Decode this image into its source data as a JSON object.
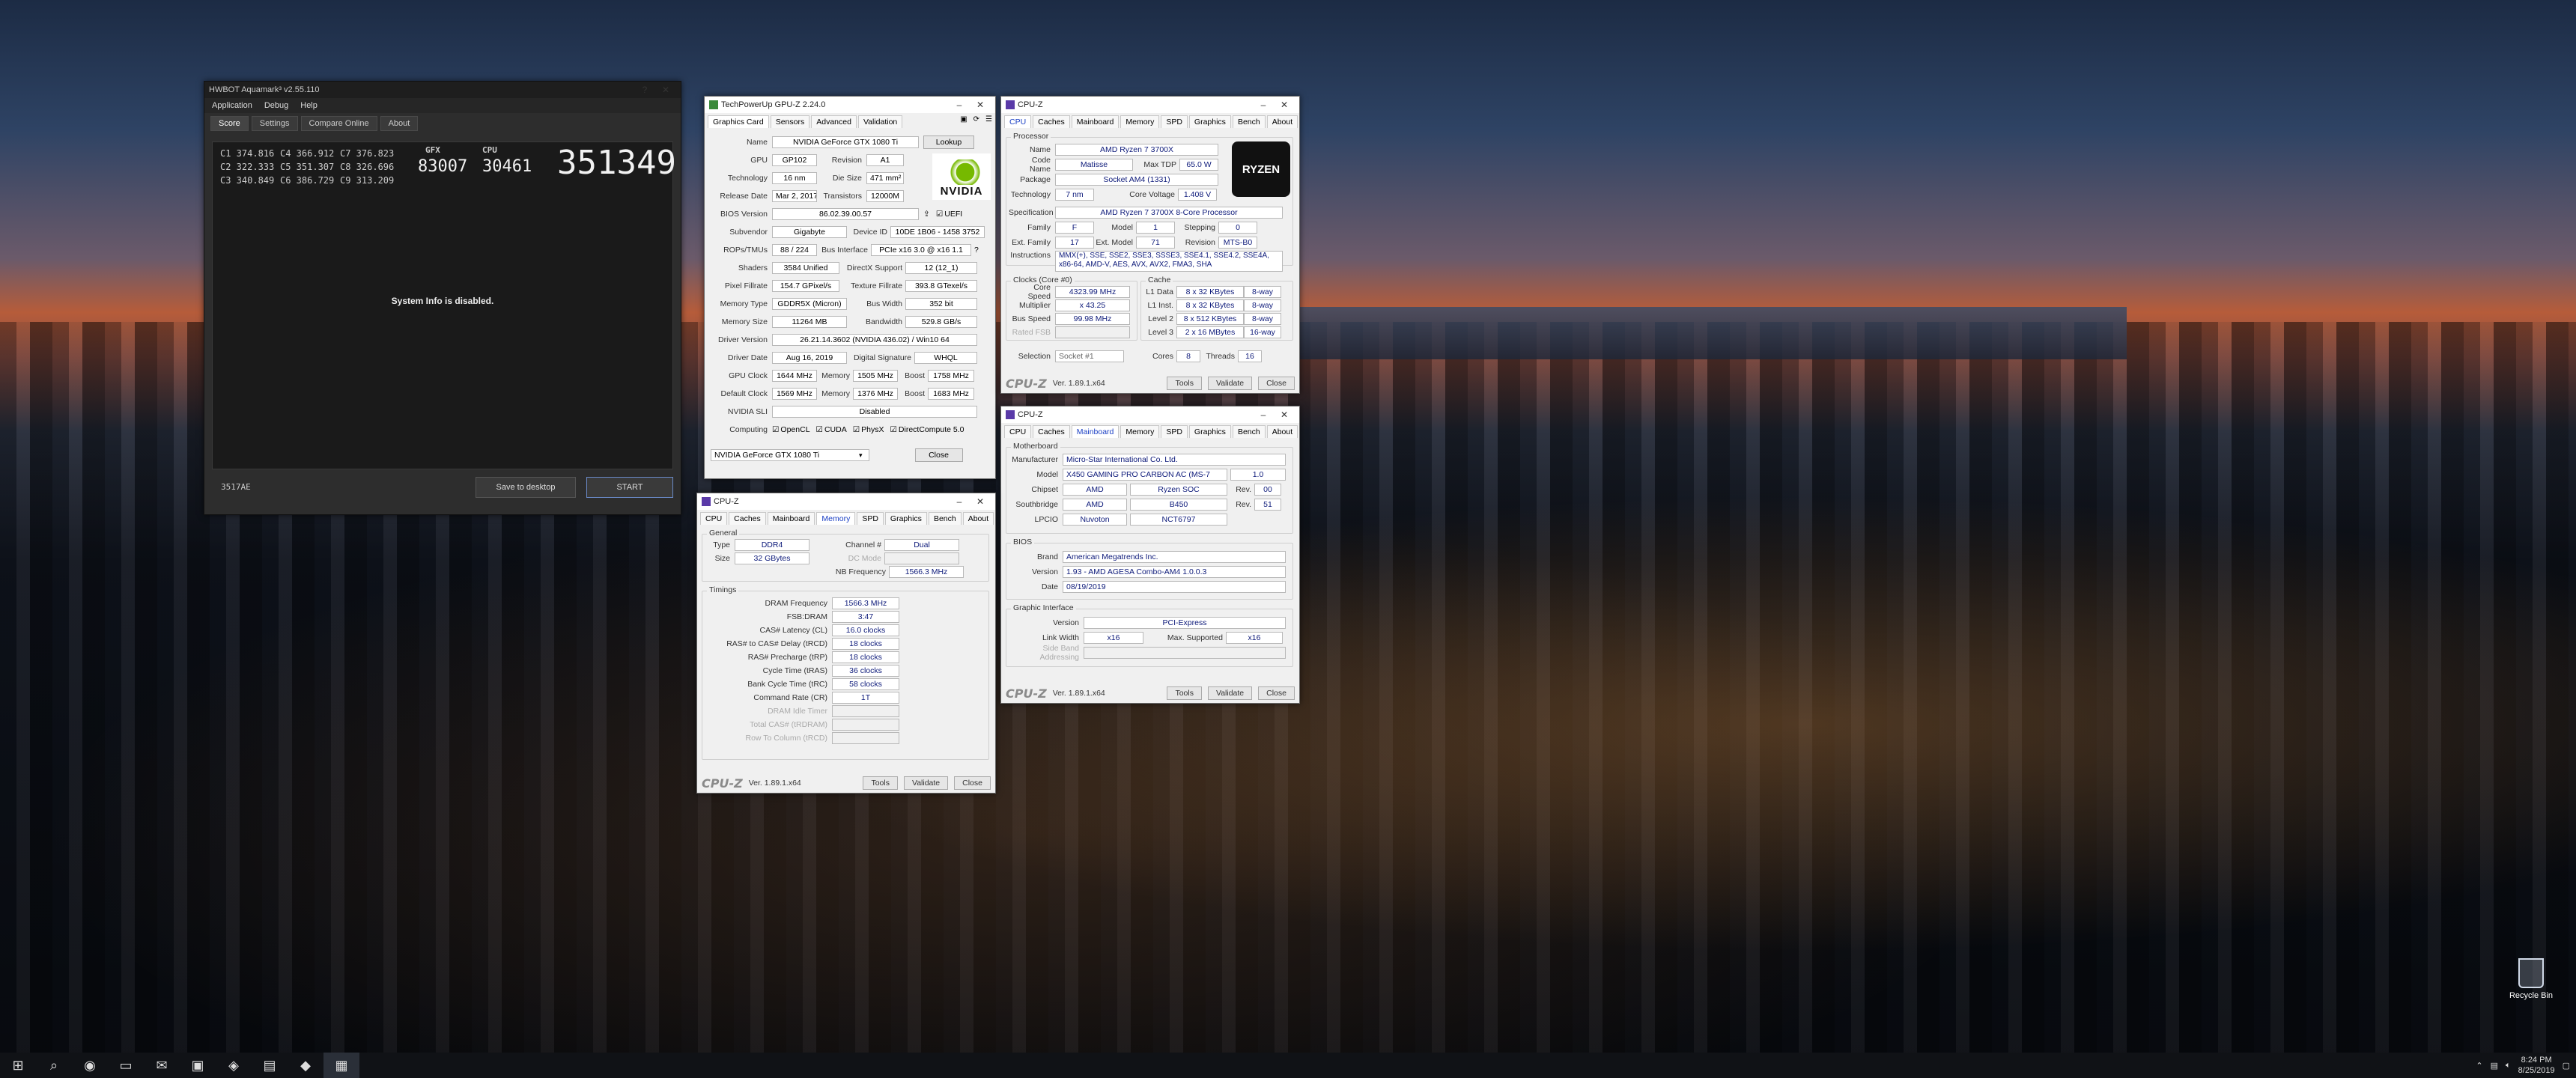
{
  "desktop": {
    "recycle_bin": "Recycle Bin"
  },
  "taskbar": {
    "time": "8:24 PM",
    "date": "8/25/2019"
  },
  "aquamark": {
    "title": "HWBOT Aquamark³ v2.55.110",
    "menu": [
      "Application",
      "Debug",
      "Help"
    ],
    "tabs": [
      "Score",
      "Settings",
      "Compare Online",
      "About"
    ],
    "scores": [
      "C1 374.816",
      "C4 366.912",
      "C7 376.823",
      "C2 322.333",
      "C5 351.307",
      "C8 326.696",
      "C3 340.849",
      "C6 386.729",
      "C9 313.209"
    ],
    "gfx_label": "GFX",
    "gfx_value": "83007",
    "cpu_label": "CPU",
    "cpu_value": "30461",
    "total": "351349",
    "system_info": "System Info is disabled.",
    "code": "3517AE",
    "save": "Save to desktop",
    "start": "START"
  },
  "gpuz": {
    "title": "TechPowerUp GPU-Z 2.24.0",
    "tabs": [
      "Graphics Card",
      "Sensors",
      "Advanced",
      "Validation"
    ],
    "name_label": "Name",
    "name": "NVIDIA GeForce GTX 1080 Ti",
    "lookup": "Lookup",
    "gpu_label": "GPU",
    "gpu": "GP102",
    "revision_label": "Revision",
    "revision": "A1",
    "tech_label": "Technology",
    "tech": "16 nm",
    "die_label": "Die Size",
    "die": "471 mm²",
    "release_label": "Release Date",
    "release": "Mar 2, 2017",
    "trans_label": "Transistors",
    "trans": "12000M",
    "bios_label": "BIOS Version",
    "bios": "86.02.39.00.57",
    "uefi": "UEFI",
    "subvendor_label": "Subvendor",
    "subvendor": "Gigabyte",
    "devid_label": "Device ID",
    "devid": "10DE 1B06 - 1458 3752",
    "rops_label": "ROPs/TMUs",
    "rops": "88 / 224",
    "bus_label": "Bus Interface",
    "bus": "PCIe x16 3.0 @ x16 1.1",
    "shaders_label": "Shaders",
    "shaders": "3584 Unified",
    "dx_label": "DirectX Support",
    "dx": "12 (12_1)",
    "pixel_label": "Pixel Fillrate",
    "pixel": "154.7 GPixel/s",
    "tex_label": "Texture Fillrate",
    "tex": "393.8 GTexel/s",
    "memtype_label": "Memory Type",
    "memtype": "GDDR5X (Micron)",
    "buswidth_label": "Bus Width",
    "buswidth": "352 bit",
    "memsize_label": "Memory Size",
    "memsize": "11264 MB",
    "bw_label": "Bandwidth",
    "bw": "529.8 GB/s",
    "driver_label": "Driver Version",
    "driver": "26.21.14.3602 (NVIDIA 436.02) / Win10 64",
    "ddate_label": "Driver Date",
    "ddate": "Aug 16, 2019",
    "dsig_label": "Digital Signature",
    "dsig": "WHQL",
    "gclock_label": "GPU Clock",
    "gclock": "1644 MHz",
    "mem_label": "Memory",
    "mem": "1505 MHz",
    "boost_label": "Boost",
    "boost": "1758 MHz",
    "dclock_label": "Default Clock",
    "dclock": "1569 MHz",
    "dmem": "1376 MHz",
    "dboost": "1683 MHz",
    "sli_label": "NVIDIA SLI",
    "sli": "Disabled",
    "computing_label": "Computing",
    "computing": [
      "OpenCL",
      "CUDA",
      "PhysX",
      "DirectCompute 5.0"
    ],
    "select": "NVIDIA GeForce GTX 1080 Ti",
    "close": "Close",
    "logo": "NVIDIA"
  },
  "cpuz_cpu": {
    "title": "CPU-Z",
    "tabs": [
      "CPU",
      "Caches",
      "Mainboard",
      "Memory",
      "SPD",
      "Graphics",
      "Bench",
      "About"
    ],
    "processor": "Processor",
    "name_label": "Name",
    "name": "AMD Ryzen 7 3700X",
    "code_label": "Code Name",
    "code": "Matisse",
    "tdp_label": "Max TDP",
    "tdp": "65.0 W",
    "package_label": "Package",
    "package": "Socket AM4 (1331)",
    "tech_label": "Technology",
    "tech": "7 nm",
    "cv_label": "Core Voltage",
    "cv": "1.408 V",
    "spec_label": "Specification",
    "spec": "AMD Ryzen 7 3700X 8-Core Processor",
    "family_label": "Family",
    "family": "F",
    "model_label": "Model",
    "model": "1",
    "stepping_label": "Stepping",
    "stepping": "0",
    "extfam_label": "Ext. Family",
    "extfam": "17",
    "extmod_label": "Ext. Model",
    "extmod": "71",
    "rev_label": "Revision",
    "rev": "MTS-B0",
    "instr_label": "Instructions",
    "instr": "MMX(+), SSE, SSE2, SSE3, SSSE3, SSE4.1, SSE4.2, SSE4A, x86-64, AMD-V, AES, AVX, AVX2, FMA3, SHA",
    "clocks": "Clocks (Core #0)",
    "cache": "Cache",
    "cs_label": "Core Speed",
    "cs": "4323.99 MHz",
    "mult_label": "Multiplier",
    "mult": "x 43.25",
    "bs_label": "Bus Speed",
    "bs": "99.98 MHz",
    "fsb_label": "Rated FSB",
    "l1d_label": "L1 Data",
    "l1d": "8 x 32 KBytes",
    "l1d_w": "8-way",
    "l1i_label": "L1 Inst.",
    "l1i": "8 x 32 KBytes",
    "l1i_w": "8-way",
    "l2_label": "Level 2",
    "l2": "8 x 512 KBytes",
    "l2_w": "8-way",
    "l3_label": "Level 3",
    "l3": "2 x 16 MBytes",
    "l3_w": "16-way",
    "sel_label": "Selection",
    "sel": "Socket #1",
    "cores_label": "Cores",
    "cores": "8",
    "threads_label": "Threads",
    "threads": "16",
    "logo": "CPU-Z",
    "ver": "Ver. 1.89.1.x64",
    "tools": "Tools",
    "validate": "Validate",
    "close": "Close",
    "ryzen": "RYZEN"
  },
  "cpuz_mb": {
    "title": "CPU-Z",
    "tabs": [
      "CPU",
      "Caches",
      "Mainboard",
      "Memory",
      "SPD",
      "Graphics",
      "Bench",
      "About"
    ],
    "motherboard": "Motherboard",
    "manu_label": "Manufacturer",
    "manu": "Micro-Star International Co. Ltd.",
    "model_label": "Model",
    "model": "X450 GAMING PRO CARBON AC (MS-7",
    "model_rev": "1.0",
    "chip_label": "Chipset",
    "chip": "AMD",
    "chip2": "Ryzen SOC",
    "chiprev_label": "Rev.",
    "chiprev": "00",
    "sb_label": "Southbridge",
    "sb": "AMD",
    "sb2": "B450",
    "sbrev": "51",
    "lpc_label": "LPCIO",
    "lpc": "Nuvoton",
    "lpc2": "NCT6797",
    "bios": "BIOS",
    "brand_label": "Brand",
    "brand": "American Megatrends Inc.",
    "ver_label": "Version",
    "ver": "1.93 - AMD AGESA Combo-AM4 1.0.0.3",
    "date_label": "Date",
    "date": "08/19/2019",
    "gi": "Graphic Interface",
    "giver_label": "Version",
    "giver": "PCI-Express",
    "lw_label": "Link Width",
    "lw": "x16",
    "ms_label": "Max. Supported",
    "ms": "x16",
    "sba_label": "Side Band Addressing",
    "logo": "CPU-Z",
    "bver": "Ver. 1.89.1.x64",
    "tools": "Tools",
    "validate": "Validate",
    "close": "Close"
  },
  "cpuz_mem": {
    "title": "CPU-Z",
    "tabs": [
      "CPU",
      "Caches",
      "Mainboard",
      "Memory",
      "SPD",
      "Graphics",
      "Bench",
      "About"
    ],
    "general": "General",
    "type_label": "Type",
    "type": "DDR4",
    "ch_label": "Channel #",
    "ch": "Dual",
    "size_label": "Size",
    "size": "32 GBytes",
    "dc_label": "DC Mode",
    "nb_label": "NB Frequency",
    "nb": "1566.3 MHz",
    "timings": "Timings",
    "t": [
      [
        "DRAM Frequency",
        "1566.3 MHz"
      ],
      [
        "FSB:DRAM",
        "3:47"
      ],
      [
        "CAS# Latency (CL)",
        "16.0 clocks"
      ],
      [
        "RAS# to CAS# Delay (tRCD)",
        "18 clocks"
      ],
      [
        "RAS# Precharge (tRP)",
        "18 clocks"
      ],
      [
        "Cycle Time (tRAS)",
        "36 clocks"
      ],
      [
        "Bank Cycle Time (tRC)",
        "58 clocks"
      ],
      [
        "Command Rate (CR)",
        "1T"
      ]
    ],
    "g": [
      "DRAM Idle Timer",
      "Total CAS# (tRDRAM)",
      "Row To Column (tRCD)"
    ],
    "logo": "CPU-Z",
    "ver": "Ver. 1.89.1.x64",
    "tools": "Tools",
    "validate": "Validate",
    "close": "Close"
  }
}
